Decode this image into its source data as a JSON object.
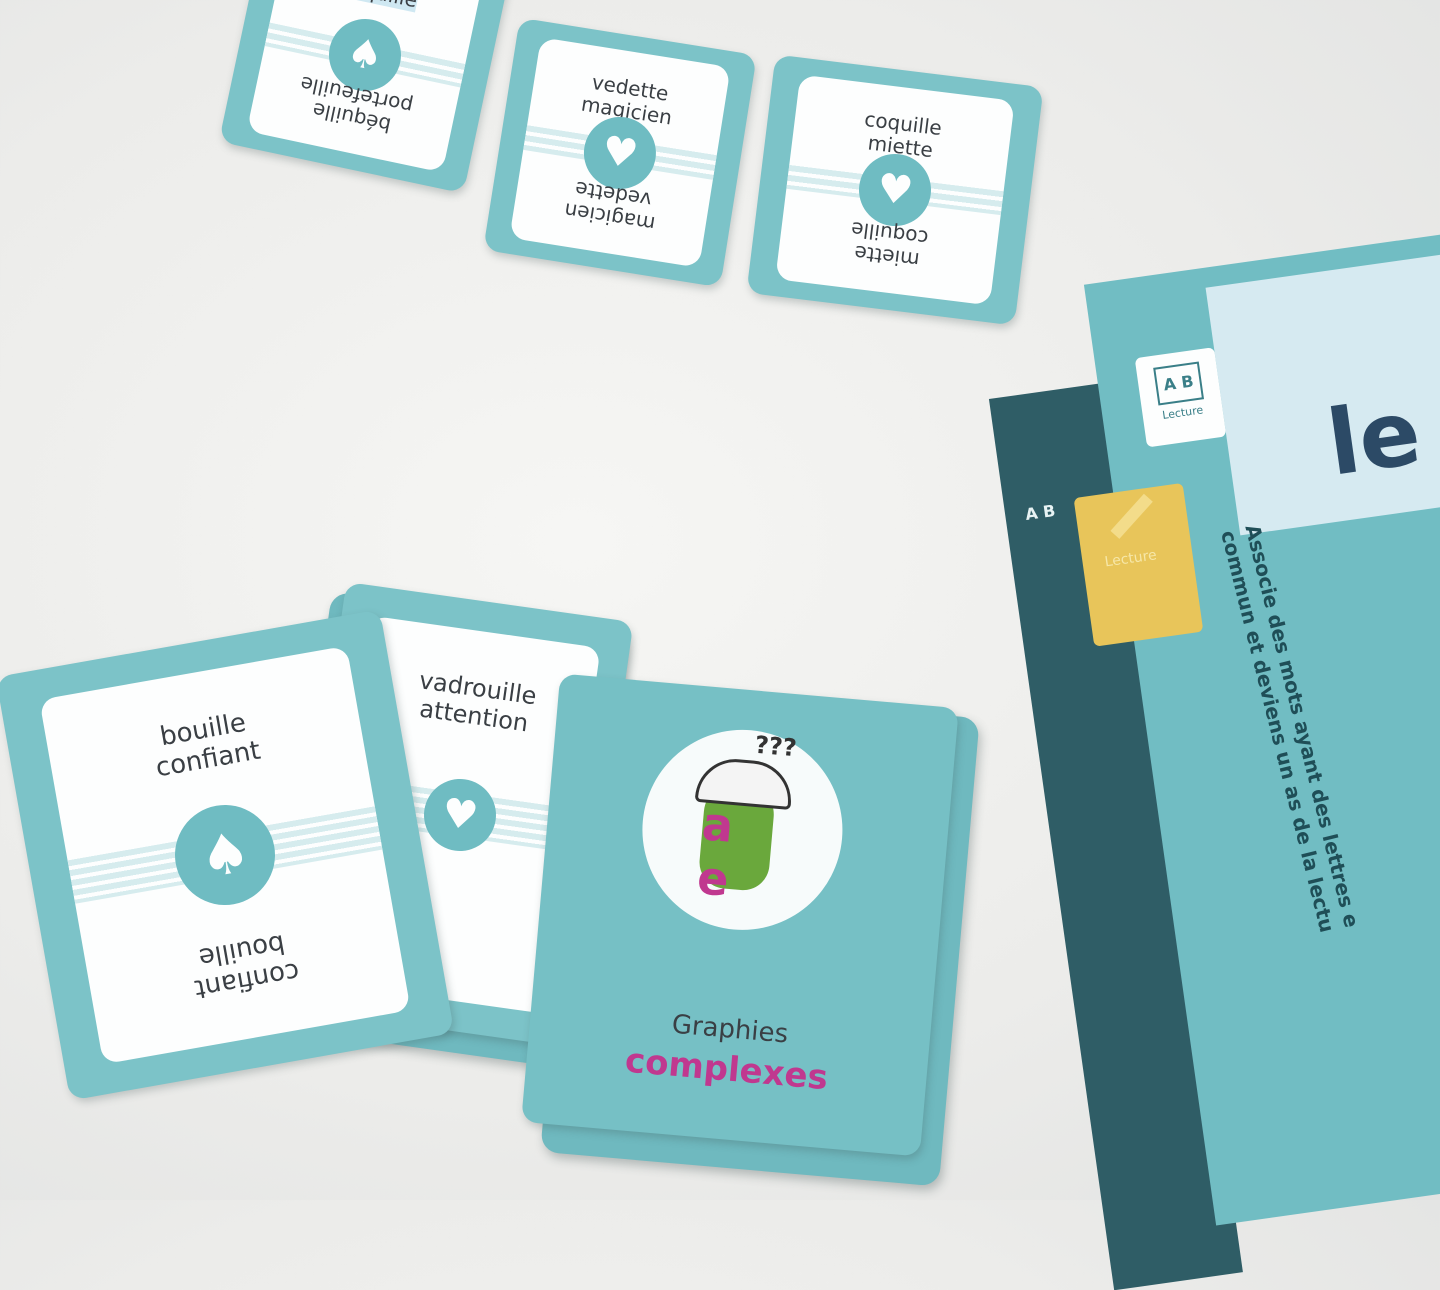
{
  "cards_top": [
    {
      "name": "card-bequille",
      "top": "béquille",
      "bottom_1": "portefeuille",
      "bottom_2": "béquille"
    },
    {
      "name": "card-vedette",
      "top_1": "vedette",
      "top_2": "magicien",
      "bottom_1": "vedette",
      "bottom_2": "magicien"
    },
    {
      "name": "card-coquille",
      "top_1": "coquille",
      "top_2": "miette",
      "bottom_1": "coquille",
      "bottom_2": "miette"
    }
  ],
  "cards_bottom": [
    {
      "name": "card-bouille",
      "top_1": "bouille",
      "top_2": "confiant",
      "bottom_1": "bouille",
      "bottom_2": "confiant"
    },
    {
      "name": "card-vadrouille",
      "top_1": "vadrouille",
      "top_2": "attention"
    }
  ],
  "deck": {
    "line_1": "Graphies",
    "line_2": "complexes",
    "emblem_letters": "a  e",
    "question": "???"
  },
  "box": {
    "chip_letters": "A B",
    "chip_label": "Lecture",
    "spine_letters": "A B",
    "yellow_label": "Lecture",
    "tagline_1": "Associe des mots ayant des lettres e",
    "tagline_2": "commun et deviens un as de la lectu",
    "logo": "le"
  },
  "colors": {
    "card_teal": "#7cc3c8",
    "card_face": "#fdfefe",
    "highlight": "#cfe8f2",
    "pink": "#c0388f",
    "box_dark": "#2f5d66"
  }
}
